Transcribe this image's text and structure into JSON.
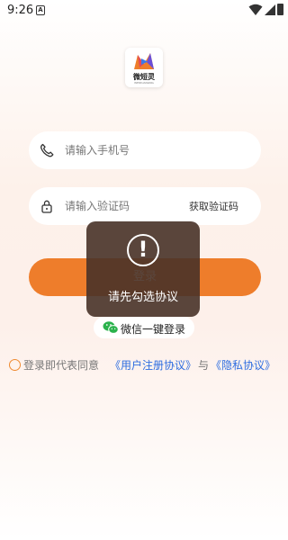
{
  "status_bar": {
    "time": "9:26",
    "notification_glyph": "A",
    "icons": [
      "wifi-icon",
      "signal-icon",
      "battery-icon"
    ]
  },
  "logo": {
    "name": "微短灵",
    "subtitle": "WEIDUANLING",
    "accent": "#ee7d2b"
  },
  "form": {
    "phone_placeholder": "请输入手机号",
    "code_placeholder": "请输入验证码",
    "get_code_label": "获取验证码",
    "phone_icon": "phone-icon",
    "code_icon": "lock-icon"
  },
  "login_button": {
    "label": "登录",
    "color": "#ee7d2b"
  },
  "wechat_login": {
    "label": "微信一键登录",
    "icon": "wechat-icon",
    "color": "#2bb24c"
  },
  "agreement": {
    "prefix": "登录即代表同意",
    "user_agreement": "《用户注册协议》",
    "and": "与",
    "privacy_policy": "《隐私协议》",
    "link_color": "#2d6de0"
  },
  "toast": {
    "icon": "exclamation-icon",
    "icon_glyph": "!",
    "message": "请先勾选协议"
  }
}
